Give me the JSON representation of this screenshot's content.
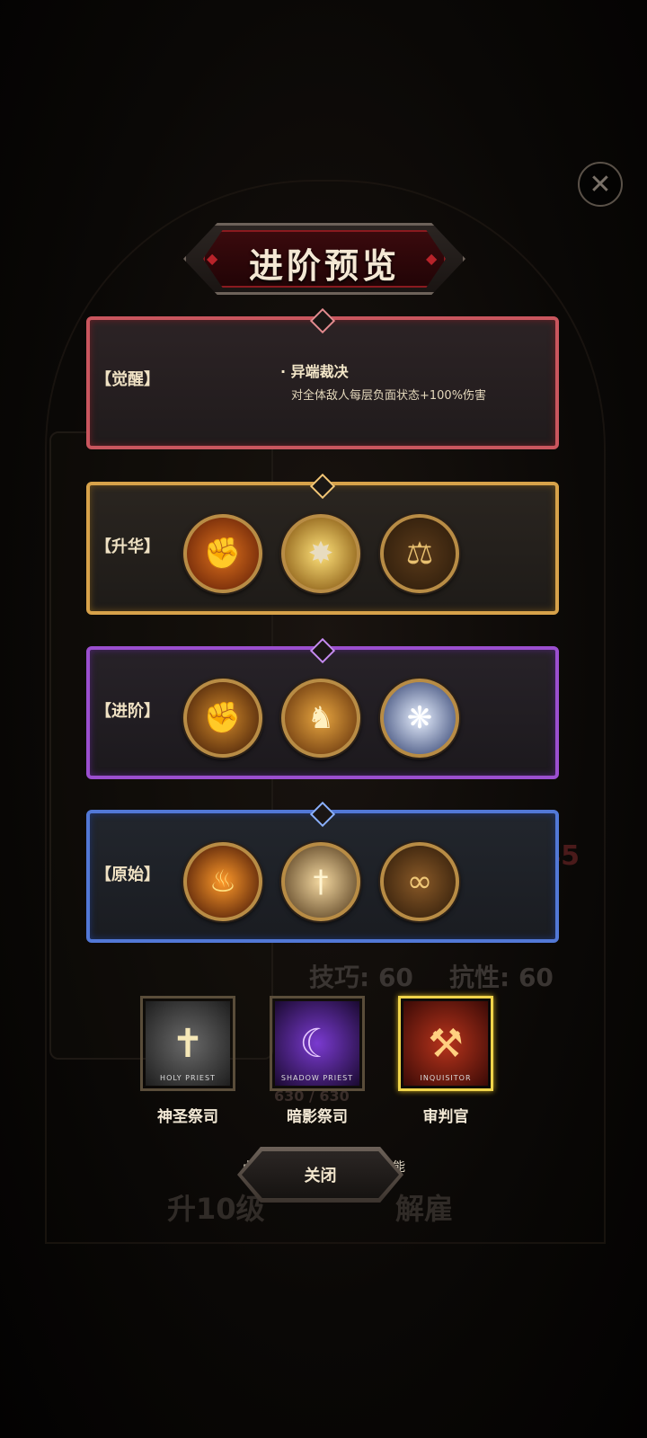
{
  "title": "进阶预览",
  "background": {
    "stats": [
      "技巧: 60",
      "抗性: 60"
    ],
    "exp": "630 / 630",
    "buttons": [
      "升10级",
      "解雇"
    ]
  },
  "panels": {
    "awaken": {
      "label": "【觉醒】",
      "skill_name": "· 异端裁决",
      "skill_desc": "对全体敌人每层负面状态+100%伤害"
    },
    "sublime": {
      "label": "【升华】",
      "icons": [
        "raised-fist-icon",
        "light-burst-icon",
        "scales-icon"
      ]
    },
    "advance": {
      "label": "【进阶】",
      "icons": [
        "fist-sun-icon",
        "angel-icon",
        "spirit-flame-icon"
      ]
    },
    "origin": {
      "label": "【原始】",
      "icons": [
        "fire-hand-icon",
        "sword-icon",
        "chains-icon"
      ]
    }
  },
  "classes": [
    {
      "name": "神圣祭司",
      "tag": "HOLY PRIEST",
      "selected": false
    },
    {
      "name": "暗影祭司",
      "tag": "SHADOW PRIEST",
      "selected": false
    },
    {
      "name": "审判官",
      "tag": "INQUISITOR",
      "selected": true
    }
  ],
  "hint": "点击下方职业，查看上方技能",
  "close_label": "关闭",
  "colors": {
    "awaken_border": "#c9565e",
    "sublime_border": "#d7a24a",
    "advance_border": "#9b4fcf",
    "origin_border": "#5278d6",
    "selected_class": "#f0d44a"
  }
}
